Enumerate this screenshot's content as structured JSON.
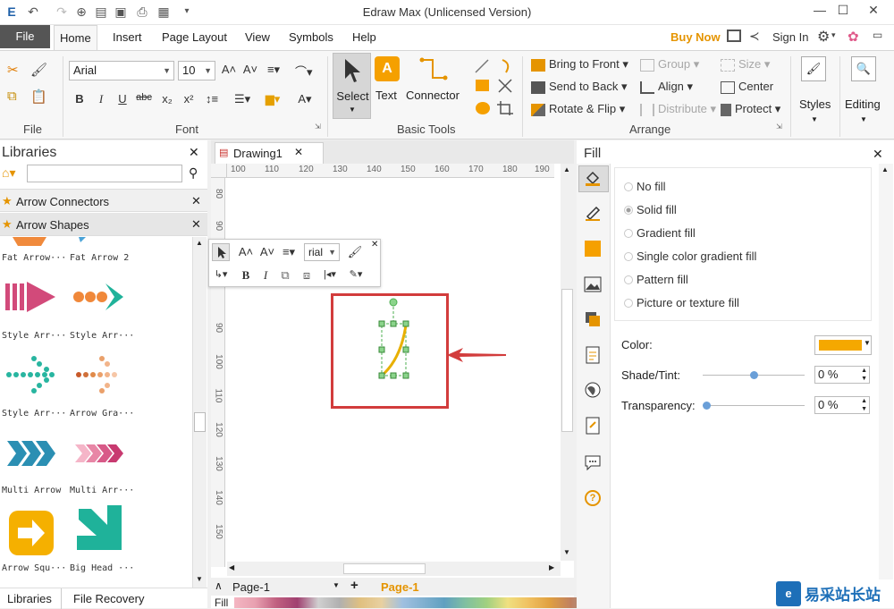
{
  "app": {
    "title": "Edraw Max (Unlicensed Version)",
    "buy_now": "Buy Now",
    "sign_in": "Sign In"
  },
  "menu_tabs": [
    "File",
    "Home",
    "Insert",
    "Page Layout",
    "View",
    "Symbols",
    "Help"
  ],
  "ribbon": {
    "groups": {
      "file": "File",
      "font": "Font",
      "basic_tools": "Basic Tools",
      "arrange": "Arrange"
    },
    "font_name": "Arial",
    "font_size": "10",
    "select": "Select",
    "text": "Text",
    "connector": "Connector",
    "bring_to_front": "Bring to Front",
    "send_to_back": "Send to Back",
    "rotate_flip": "Rotate & Flip",
    "group": "Group",
    "align": "Align",
    "distribute": "Distribute",
    "size": "Size",
    "center": "Center",
    "protect": "Protect",
    "styles": "Styles",
    "editing": "Editing"
  },
  "libraries": {
    "title": "Libraries",
    "search_placeholder": "",
    "sections": [
      "Arrow Connectors",
      "Arrow Shapes"
    ],
    "items": [
      {
        "label": "Fat Arrow···"
      },
      {
        "label": "Fat Arrow 2"
      },
      {
        "label": "Style Arr···"
      },
      {
        "label": "Style Arr···"
      },
      {
        "label": "Style Arr···"
      },
      {
        "label": "Arrow Gra···"
      },
      {
        "label": "Multi Arrow"
      },
      {
        "label": "Multi Arr···"
      },
      {
        "label": "Arrow Squ···"
      },
      {
        "label": "Big Head ···"
      }
    ],
    "bottom_tabs": [
      "Libraries",
      "File Recovery"
    ]
  },
  "document": {
    "tab": "Drawing1",
    "ruler_h": [
      "100",
      "110",
      "120",
      "130",
      "140",
      "150",
      "160",
      "170",
      "180",
      "190"
    ],
    "ruler_v": [
      "80",
      "90",
      "",
      "90",
      "100",
      "110",
      "120",
      "130",
      "140",
      "150"
    ],
    "mini_font": "rial",
    "page_select": "Page-1",
    "page_tab": "Page-1",
    "fill_label": "Fill"
  },
  "fill_panel": {
    "title": "Fill",
    "options": [
      "No fill",
      "Solid fill",
      "Gradient fill",
      "Single color gradient fill",
      "Pattern fill",
      "Picture or texture fill"
    ],
    "selected": "Solid fill",
    "color_label": "Color:",
    "color_value": "#f5a800",
    "shade_label": "Shade/Tint:",
    "shade_value": "0 %",
    "shade_level": 0.5,
    "transparency_label": "Transparency:",
    "transparency_value": "0 %",
    "transparency_level": 0
  },
  "watermark": {
    "text": "易采站长站"
  },
  "colors": {
    "accent": "#e59400",
    "highlight_box": "#d23c3c",
    "arrow": "#d23c3c",
    "shape_stroke": "#e8b000",
    "handle": "#4caf50"
  }
}
